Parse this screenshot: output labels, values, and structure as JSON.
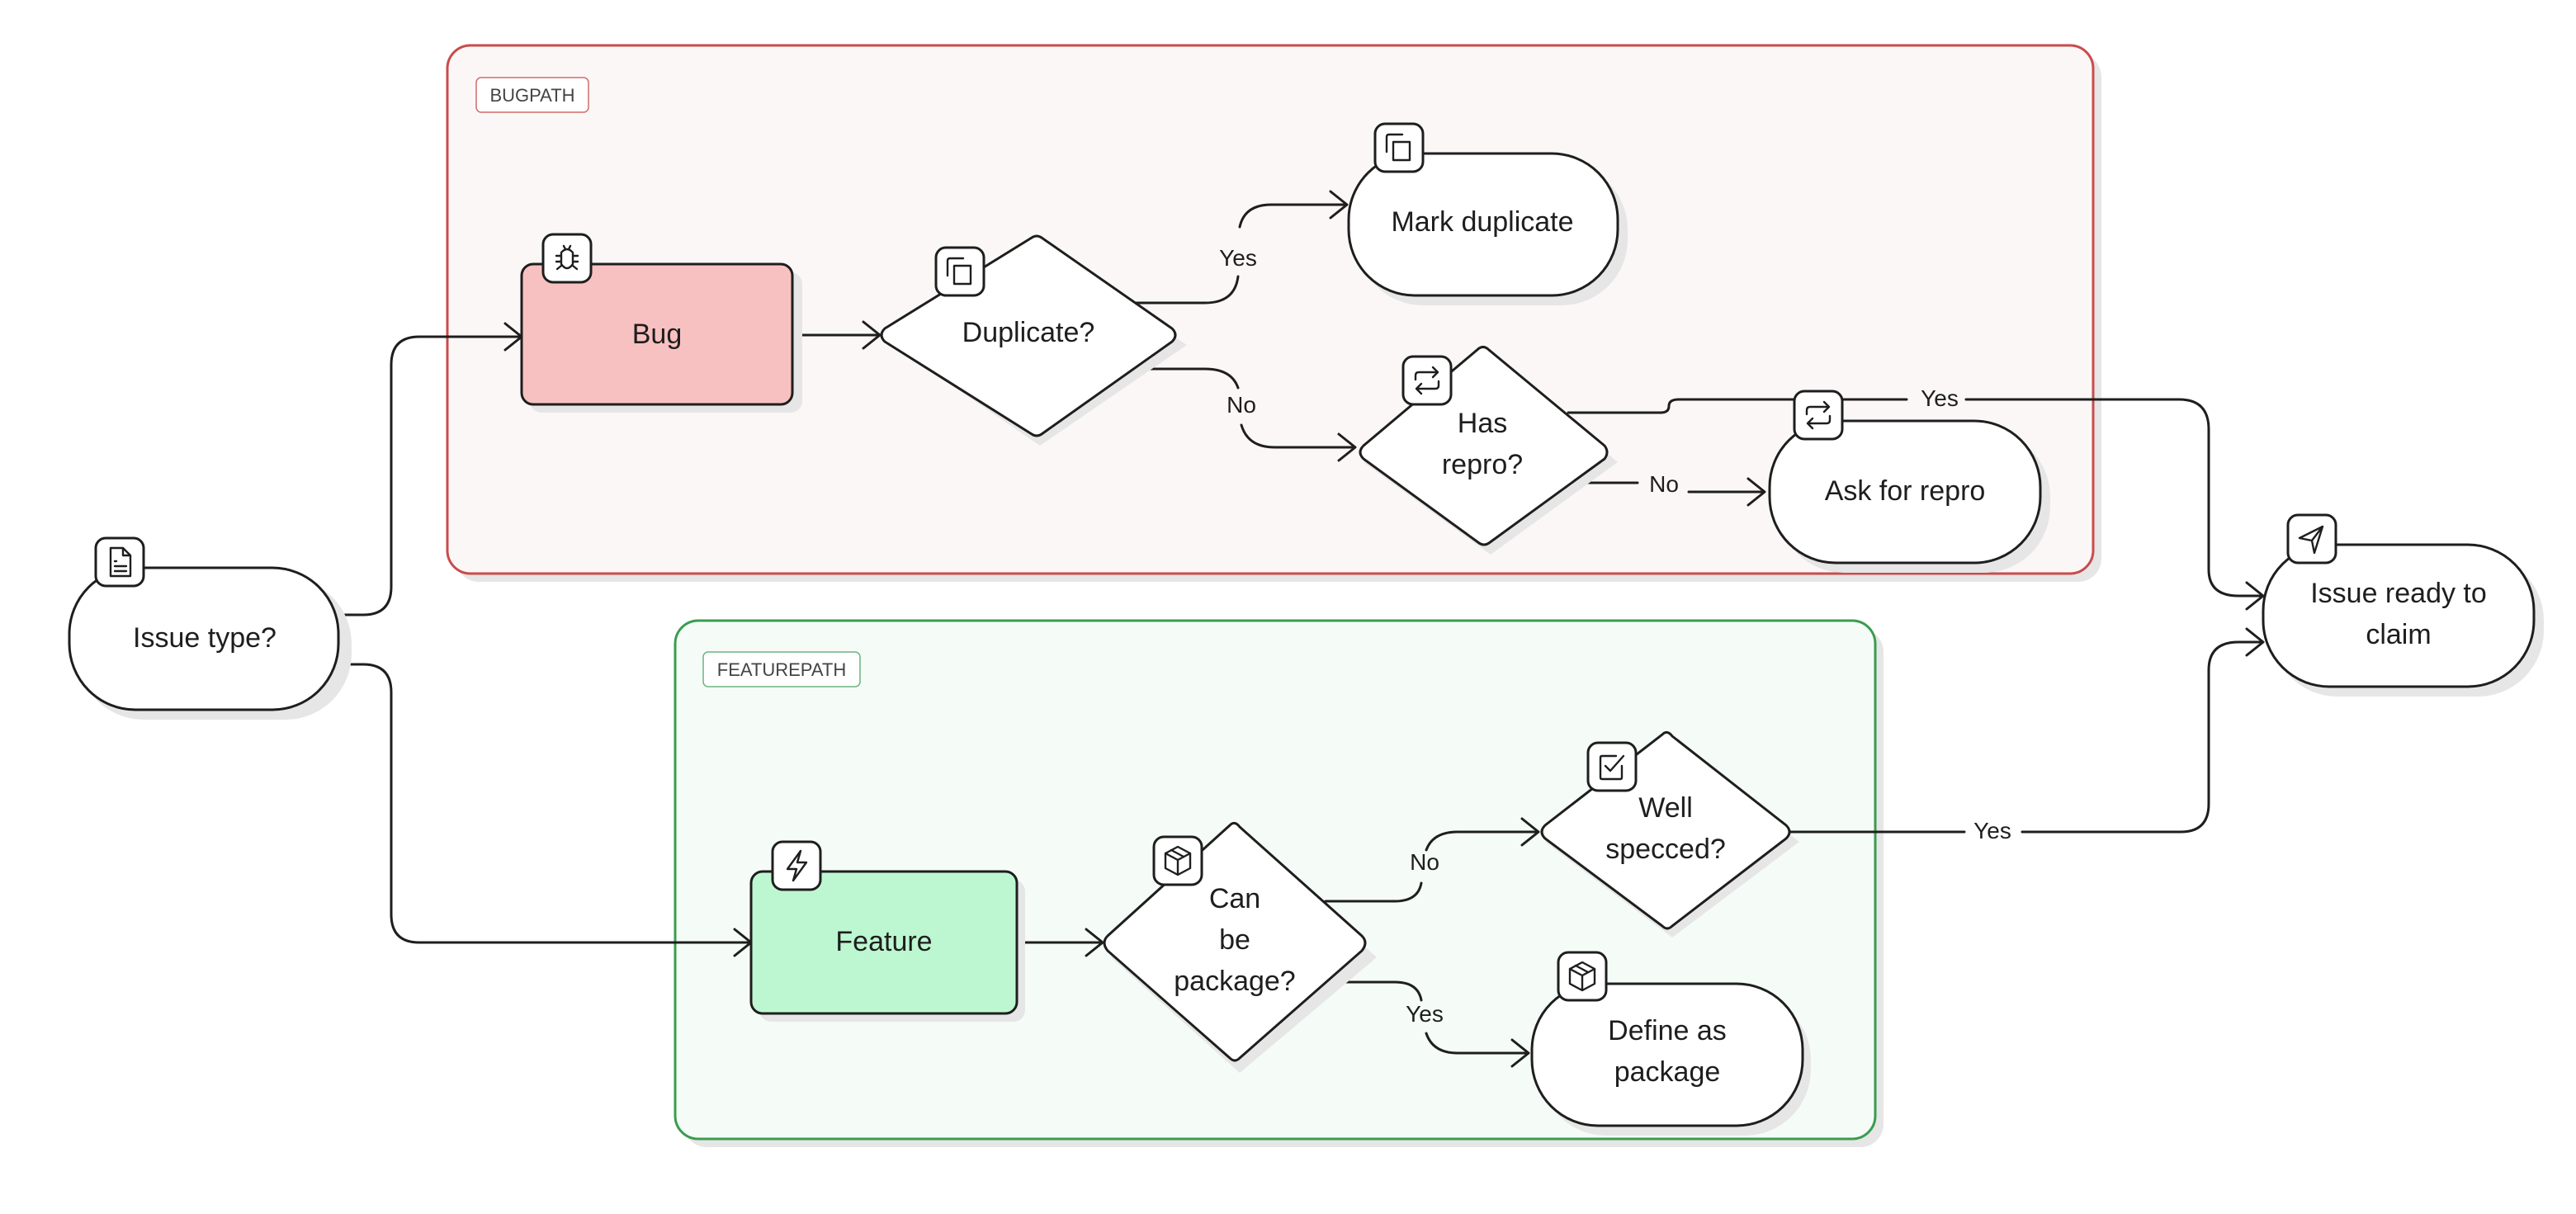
{
  "diagram": {
    "colors": {
      "bug_frame_stroke": "#c94c4c",
      "bug_frame_fill": "#fcf7f7",
      "feature_frame_stroke": "#3a9c4f",
      "feature_frame_fill": "#f5fcf7",
      "bug_node_fill": "#f8c1c1",
      "feature_node_fill": "#bdf7d1",
      "node_fill": "#ffffff",
      "stroke": "#1e1e1e"
    },
    "frames": {
      "bugpath": {
        "label": "BUGPATH"
      },
      "featurepath": {
        "label": "FEATUREPATH"
      }
    },
    "nodes": {
      "issue_type": {
        "label": "Issue type?",
        "icon": "document-icon",
        "shape": "rounded"
      },
      "bug": {
        "label": "Bug",
        "icon": "bug-icon",
        "shape": "rect"
      },
      "duplicate": {
        "label": "Duplicate?",
        "icon": "copy-icon",
        "shape": "diamond"
      },
      "mark_duplicate": {
        "label": "Mark duplicate",
        "icon": "copy-icon",
        "shape": "rounded"
      },
      "has_repro": {
        "lines": [
          "Has",
          "repro?"
        ],
        "icon": "repeat-icon",
        "shape": "diamond"
      },
      "ask_repro": {
        "label": "Ask for repro",
        "icon": "repeat-icon",
        "shape": "rounded"
      },
      "issue_ready": {
        "lines": [
          "Issue ready to",
          "claim"
        ],
        "icon": "send-icon",
        "shape": "rounded"
      },
      "feature": {
        "label": "Feature",
        "icon": "zap-icon",
        "shape": "rect"
      },
      "can_package": {
        "lines": [
          "Can",
          "be",
          "package?"
        ],
        "icon": "package-icon",
        "shape": "diamond"
      },
      "well_specced": {
        "lines": [
          "Well",
          "specced?"
        ],
        "icon": "checkbox-icon",
        "shape": "diamond"
      },
      "define_package": {
        "lines": [
          "Define as",
          "package"
        ],
        "icon": "package-icon",
        "shape": "rounded"
      }
    },
    "edges": {
      "dup_yes": "Yes",
      "dup_no": "No",
      "repro_yes": "Yes",
      "repro_no": "No",
      "pkg_no": "No",
      "pkg_yes": "Yes",
      "spec_yes": "Yes"
    }
  }
}
